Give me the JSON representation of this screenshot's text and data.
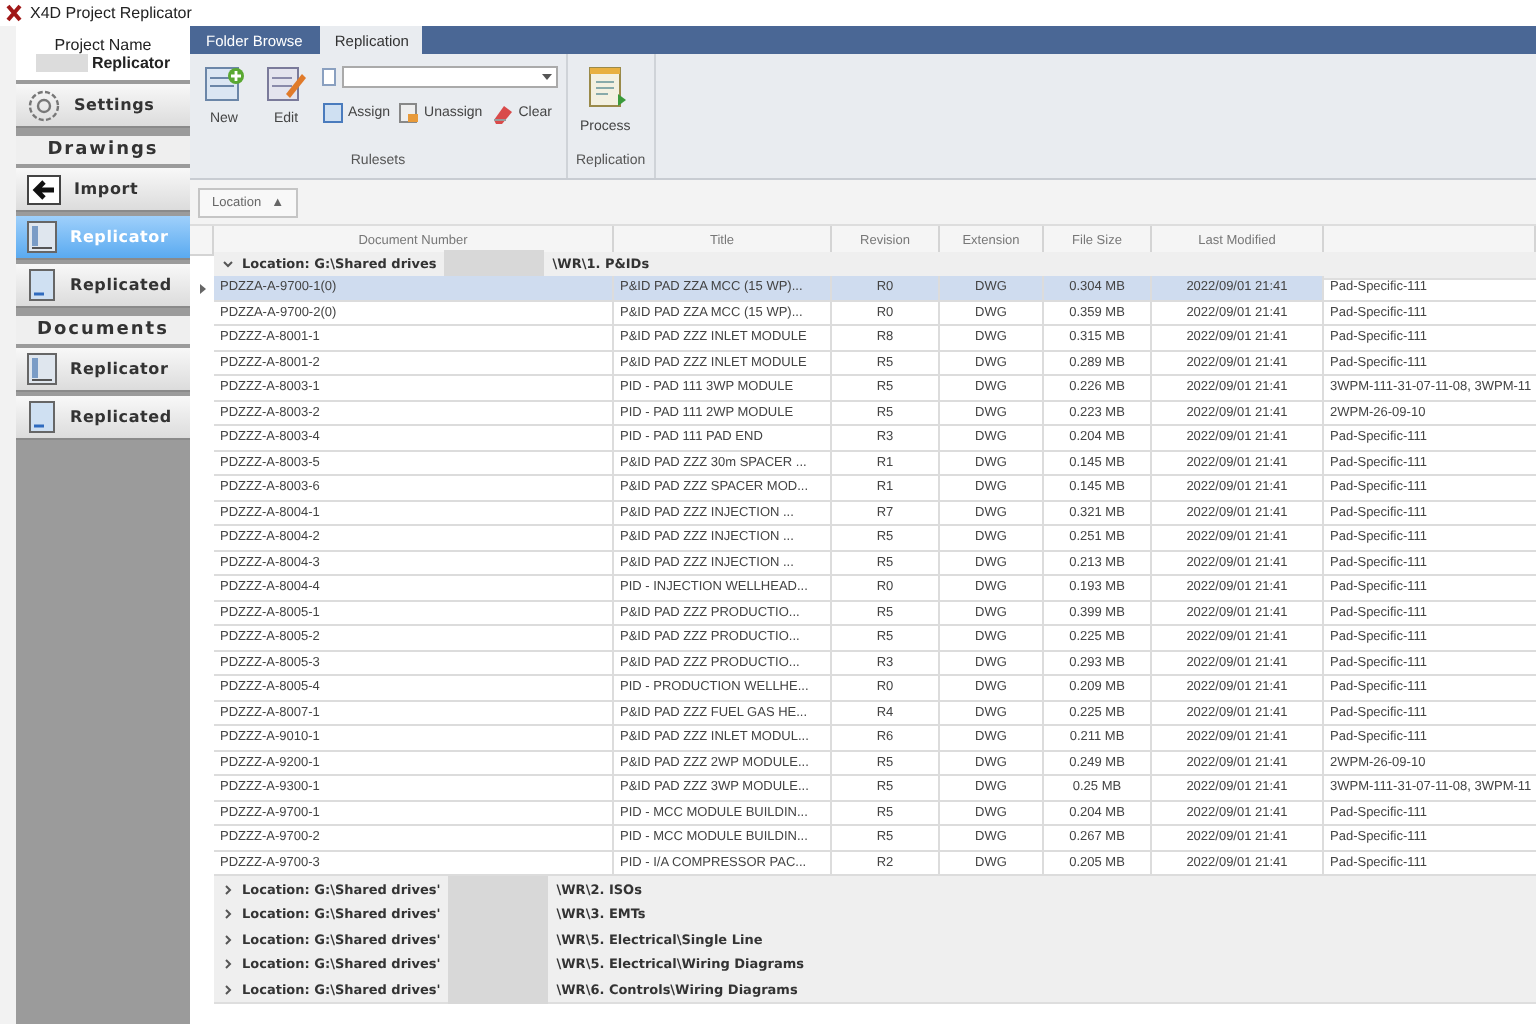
{
  "window": {
    "title": "X4D Project Replicator"
  },
  "project": {
    "label": "Project Name",
    "name": "Replicator"
  },
  "sidebar": [
    {
      "kind": "settings",
      "label": "Settings",
      "selected": false
    },
    {
      "kind": "header",
      "label": "Drawings"
    },
    {
      "kind": "import",
      "label": "Import",
      "selected": false
    },
    {
      "kind": "replicator",
      "label": "Replicator",
      "selected": true
    },
    {
      "kind": "replicated",
      "label": "Replicated",
      "selected": false
    },
    {
      "kind": "header",
      "label": "Documents"
    },
    {
      "kind": "replicator",
      "label": "Replicator",
      "selected": false
    },
    {
      "kind": "replicated",
      "label": "Replicated",
      "selected": false
    }
  ],
  "tabs": [
    {
      "label": "Folder Browse",
      "selected": false
    },
    {
      "label": "Replication",
      "selected": true
    }
  ],
  "ribbon_groups": [
    {
      "label": "Rulesets",
      "items": [
        {
          "kind": "new",
          "label": "New"
        },
        {
          "kind": "edit",
          "label": "Edit"
        },
        {
          "kind": "combo"
        },
        {
          "kind": "assign",
          "label": "Assign"
        },
        {
          "kind": "unassign",
          "label": "Unassign"
        },
        {
          "kind": "clear",
          "label": "Clear"
        }
      ]
    },
    {
      "label": "Replication",
      "items": [
        {
          "kind": "process",
          "label": "Process"
        }
      ]
    }
  ],
  "group_by": {
    "label": "Location",
    "arrow": "▲"
  },
  "table": {
    "columns": [
      "Document Number",
      "Title",
      "Revision",
      "Extension",
      "File Size",
      "Last Modified"
    ],
    "groups": [
      {
        "prefix": "Location: G:\\Shared drives",
        "suffix": "\\WR\\1. P&IDs",
        "expanded": true,
        "rows": [
          {
            "selected": true,
            "cells": [
              "PDZZA-A-9700-1(0)",
              "P&ID PAD ZZA MCC (15 WP)...",
              "R0",
              "DWG",
              "0.304 MB",
              "2022/09/01 21:41",
              "Pad-Specific-111"
            ]
          },
          {
            "selected": false,
            "cells": [
              "PDZZA-A-9700-2(0)",
              "P&ID PAD ZZA MCC (15 WP)...",
              "R0",
              "DWG",
              "0.359 MB",
              "2022/09/01 21:41",
              "Pad-Specific-111"
            ]
          },
          {
            "selected": false,
            "cells": [
              "PDZZZ-A-8001-1",
              "P&ID PAD ZZZ INLET MODULE",
              "R8",
              "DWG",
              "0.315 MB",
              "2022/09/01 21:41",
              "Pad-Specific-111"
            ]
          },
          {
            "selected": false,
            "cells": [
              "PDZZZ-A-8001-2",
              "P&ID PAD ZZZ INLET MODULE",
              "R5",
              "DWG",
              "0.289 MB",
              "2022/09/01 21:41",
              "Pad-Specific-111"
            ]
          },
          {
            "selected": false,
            "cells": [
              "PDZZZ-A-8003-1",
              "PID - PAD 111 3WP MODULE",
              "R5",
              "DWG",
              "0.226 MB",
              "2022/09/01 21:41",
              "3WPM-111-31-07-11-08, 3WPM-11"
            ]
          },
          {
            "selected": false,
            "cells": [
              "PDZZZ-A-8003-2",
              "PID - PAD 111 2WP MODULE",
              "R5",
              "DWG",
              "0.223 MB",
              "2022/09/01 21:41",
              "2WPM-26-09-10"
            ]
          },
          {
            "selected": false,
            "cells": [
              "PDZZZ-A-8003-4",
              "PID - PAD 111 PAD END",
              "R3",
              "DWG",
              "0.204 MB",
              "2022/09/01 21:41",
              "Pad-Specific-111"
            ]
          },
          {
            "selected": false,
            "cells": [
              "PDZZZ-A-8003-5",
              "P&ID PAD ZZZ 30m SPACER ...",
              "R1",
              "DWG",
              "0.145 MB",
              "2022/09/01 21:41",
              "Pad-Specific-111"
            ]
          },
          {
            "selected": false,
            "cells": [
              "PDZZZ-A-8003-6",
              "P&ID PAD ZZZ SPACER MOD...",
              "R1",
              "DWG",
              "0.145 MB",
              "2022/09/01 21:41",
              "Pad-Specific-111"
            ]
          },
          {
            "selected": false,
            "cells": [
              "PDZZZ-A-8004-1",
              "P&ID PAD ZZZ INJECTION ...",
              "R7",
              "DWG",
              "0.321 MB",
              "2022/09/01 21:41",
              "Pad-Specific-111"
            ]
          },
          {
            "selected": false,
            "cells": [
              "PDZZZ-A-8004-2",
              "P&ID PAD ZZZ INJECTION ...",
              "R5",
              "DWG",
              "0.251 MB",
              "2022/09/01 21:41",
              "Pad-Specific-111"
            ]
          },
          {
            "selected": false,
            "cells": [
              "PDZZZ-A-8004-3",
              "P&ID PAD ZZZ INJECTION ...",
              "R5",
              "DWG",
              "0.213 MB",
              "2022/09/01 21:41",
              "Pad-Specific-111"
            ]
          },
          {
            "selected": false,
            "cells": [
              "PDZZZ-A-8004-4",
              "PID - INJECTION WELLHEAD...",
              "R0",
              "DWG",
              "0.193 MB",
              "2022/09/01 21:41",
              "Pad-Specific-111"
            ]
          },
          {
            "selected": false,
            "cells": [
              "PDZZZ-A-8005-1",
              "P&ID PAD ZZZ PRODUCTIO...",
              "R5",
              "DWG",
              "0.399 MB",
              "2022/09/01 21:41",
              "Pad-Specific-111"
            ]
          },
          {
            "selected": false,
            "cells": [
              "PDZZZ-A-8005-2",
              "P&ID PAD ZZZ PRODUCTIO...",
              "R5",
              "DWG",
              "0.225 MB",
              "2022/09/01 21:41",
              "Pad-Specific-111"
            ]
          },
          {
            "selected": false,
            "cells": [
              "PDZZZ-A-8005-3",
              "P&ID PAD ZZZ PRODUCTIO...",
              "R3",
              "DWG",
              "0.293 MB",
              "2022/09/01 21:41",
              "Pad-Specific-111"
            ]
          },
          {
            "selected": false,
            "cells": [
              "PDZZZ-A-8005-4",
              "PID - PRODUCTION WELLHE...",
              "R0",
              "DWG",
              "0.209 MB",
              "2022/09/01 21:41",
              "Pad-Specific-111"
            ]
          },
          {
            "selected": false,
            "cells": [
              "PDZZZ-A-8007-1",
              "P&ID PAD ZZZ FUEL GAS HE...",
              "R4",
              "DWG",
              "0.225 MB",
              "2022/09/01 21:41",
              "Pad-Specific-111"
            ]
          },
          {
            "selected": false,
            "cells": [
              "PDZZZ-A-9010-1",
              "P&ID PAD ZZZ INLET MODUL...",
              "R6",
              "DWG",
              "0.211 MB",
              "2022/09/01 21:41",
              "Pad-Specific-111"
            ]
          },
          {
            "selected": false,
            "cells": [
              "PDZZZ-A-9200-1",
              "P&ID PAD ZZZ 2WP MODULE...",
              "R5",
              "DWG",
              "0.249 MB",
              "2022/09/01 21:41",
              "2WPM-26-09-10"
            ]
          },
          {
            "selected": false,
            "cells": [
              "PDZZZ-A-9300-1",
              "P&ID PAD ZZZ 3WP MODULE...",
              "R5",
              "DWG",
              "0.25 MB",
              "2022/09/01 21:41",
              "3WPM-111-31-07-11-08, 3WPM-11"
            ]
          },
          {
            "selected": false,
            "cells": [
              "PDZZZ-A-9700-1",
              "PID - MCC MODULE BUILDIN...",
              "R5",
              "DWG",
              "0.204 MB",
              "2022/09/01 21:41",
              "Pad-Specific-111"
            ]
          },
          {
            "selected": false,
            "cells": [
              "PDZZZ-A-9700-2",
              "PID - MCC MODULE BUILDIN...",
              "R5",
              "DWG",
              "0.267 MB",
              "2022/09/01 21:41",
              "Pad-Specific-111"
            ]
          },
          {
            "selected": false,
            "cells": [
              "PDZZZ-A-9700-3",
              "PID - I/A COMPRESSOR PAC...",
              "R2",
              "DWG",
              "0.205 MB",
              "2022/09/01 21:41",
              "Pad-Specific-111"
            ]
          }
        ]
      },
      {
        "prefix": "Location: G:\\Shared drives'",
        "suffix": "\\WR\\2. ISOs",
        "expanded": false
      },
      {
        "prefix": "Location: G:\\Shared drives'",
        "suffix": "\\WR\\3. EMTs",
        "expanded": false
      },
      {
        "prefix": "Location: G:\\Shared drives'",
        "suffix": "\\WR\\5. Electrical\\Single Line",
        "expanded": false
      },
      {
        "prefix": "Location: G:\\Shared drives'",
        "suffix": "\\WR\\5. Electrical\\Wiring Diagrams",
        "expanded": false
      },
      {
        "prefix": "Location: G:\\Shared drives'",
        "suffix": "\\WR\\6. Controls\\Wiring Diagrams",
        "expanded": false
      }
    ]
  }
}
